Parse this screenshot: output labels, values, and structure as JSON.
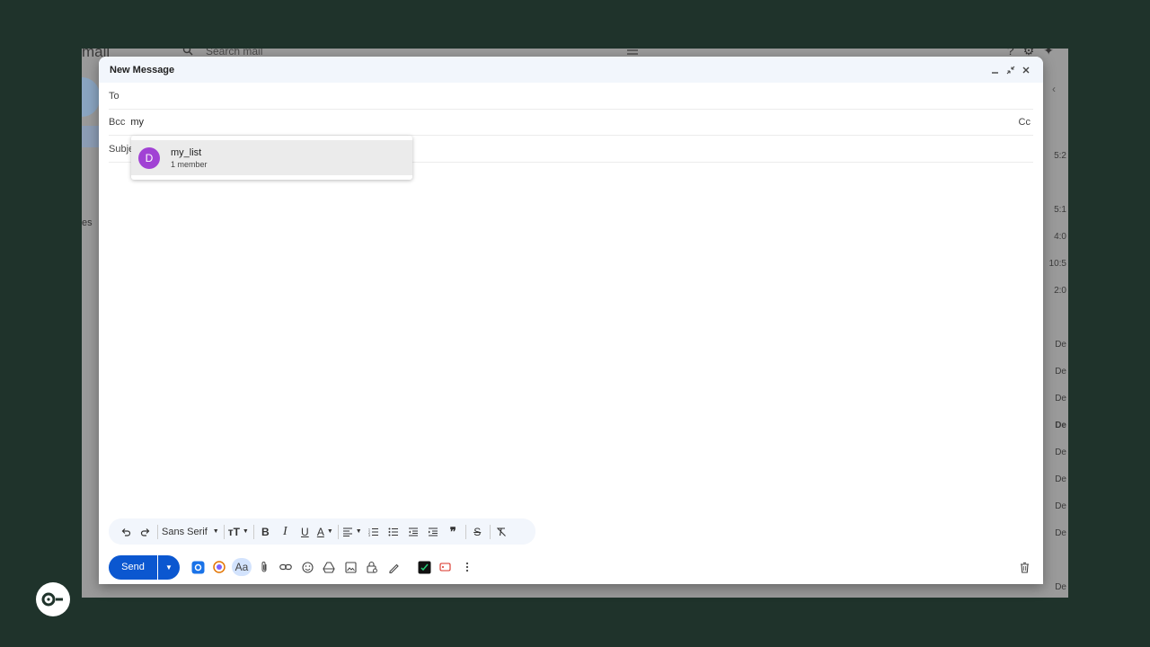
{
  "background": {
    "brand": "mail",
    "search_placeholder": "Search mail",
    "nav_text": "es",
    "right_rows": [
      "5:2",
      "5:1",
      "4:0",
      "10:5",
      "2:0",
      "De",
      "De",
      "De",
      "De",
      "De",
      "De",
      "De",
      "De",
      "De"
    ]
  },
  "compose": {
    "title": "New Message",
    "to_label": "To",
    "to_value": "",
    "bcc_label": "Bcc",
    "bcc_value": "my",
    "cc_label": "Cc",
    "subject_label": "Subje"
  },
  "suggestion": {
    "avatar_letter": "D",
    "avatar_color": "#a142d4",
    "name": "my_list",
    "subtitle": "1 member"
  },
  "toolbar": {
    "font_name": "Sans Serif"
  },
  "actions": {
    "send_label": "Send"
  },
  "colors": {
    "accent": "#0b57d0",
    "backdrop": "#1f332b"
  }
}
